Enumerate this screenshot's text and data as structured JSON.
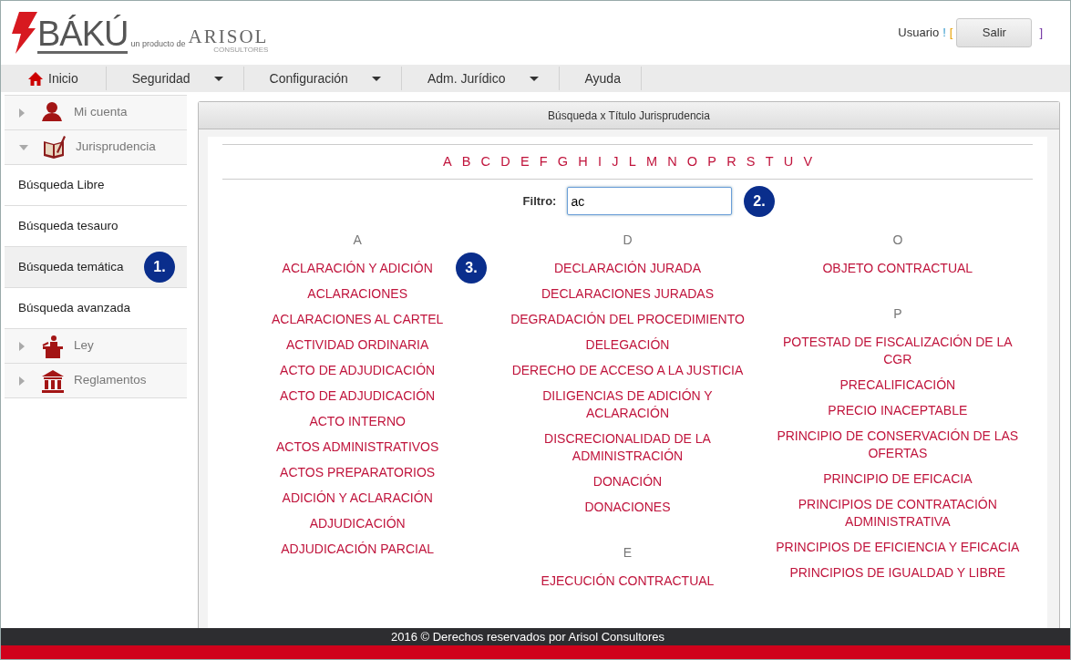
{
  "logo": {
    "brand": "BÁKÚ",
    "tagline": "un producto de",
    "company": "ARISOL",
    "company_sub": "CONSULTORES"
  },
  "user": {
    "greeting": "Usuario",
    "bang": "!",
    "open_bracket": "[",
    "button": "Salir",
    "close_bracket": "]"
  },
  "nav": [
    {
      "label": "Inicio",
      "home": true,
      "has_menu": false
    },
    {
      "label": "Seguridad",
      "home": false,
      "has_menu": true
    },
    {
      "label": "Configuración",
      "home": false,
      "has_menu": true
    },
    {
      "label": "Adm. Jurídico",
      "home": false,
      "has_menu": true
    },
    {
      "label": "Ayuda",
      "home": false,
      "has_menu": false
    }
  ],
  "sidebar": {
    "items": [
      {
        "kind": "section",
        "label": "Mi cuenta",
        "expanded": false
      },
      {
        "kind": "section",
        "label": "Jurisprudencia",
        "expanded": true
      },
      {
        "kind": "link",
        "label": "Búsqueda Libre",
        "selected": false
      },
      {
        "kind": "link",
        "label": "Búsqueda tesauro",
        "selected": false
      },
      {
        "kind": "link",
        "label": "Búsqueda temática",
        "selected": true,
        "badge": "1."
      },
      {
        "kind": "link",
        "label": "Búsqueda avanzada",
        "selected": false
      },
      {
        "kind": "section",
        "label": "Ley",
        "expanded": false
      },
      {
        "kind": "section",
        "label": "Reglamentos",
        "expanded": false
      }
    ]
  },
  "panel": {
    "title": "Búsqueda x Título Jurisprudencia",
    "letters": [
      "A",
      "B",
      "C",
      "D",
      "E",
      "F",
      "G",
      "H",
      "I",
      "J",
      "L",
      "M",
      "N",
      "O",
      "P",
      "R",
      "S",
      "T",
      "U",
      "V"
    ],
    "filter": {
      "label": "Filtro:",
      "value": "ac",
      "badge": "2."
    },
    "results_badge": "3.",
    "columns": [
      {
        "groups": [
          {
            "letter": "A",
            "items": [
              "ACLARACIÓN Y ADICIÓN",
              "ACLARACIONES",
              "ACLARACIONES AL CARTEL",
              "ACTIVIDAD ORDINARIA",
              "ACTO DE ADJUDICACIÓN",
              "ACTO DE ADJUDICACIÓN",
              "ACTO INTERNO",
              "ACTOS ADMINISTRATIVOS",
              "ACTOS PREPARATORIOS",
              "ADICIÓN Y ACLARACIÓN",
              "ADJUDICACIÓN",
              "ADJUDICACIÓN PARCIAL"
            ]
          }
        ]
      },
      {
        "groups": [
          {
            "letter": "D",
            "items": [
              "DECLARACIÓN JURADA",
              "DECLARACIONES JURADAS",
              "DEGRADACIÓN DEL PROCEDIMIENTO",
              "DELEGACIÓN",
              "DERECHO DE ACCESO A LA JUSTICIA",
              "DILIGENCIAS DE ADICIÓN Y ACLARACIÓN",
              "DISCRECIONALIDAD DE LA ADMINISTRACIÓN",
              "DONACIÓN",
              "DONACIONES"
            ]
          },
          {
            "letter": "E",
            "items": [
              "EJECUCIÓN CONTRACTUAL"
            ]
          }
        ]
      },
      {
        "groups": [
          {
            "letter": "O",
            "items": [
              "OBJETO CONTRACTUAL"
            ]
          },
          {
            "letter": "P",
            "items": [
              "POTESTAD DE FISCALIZACIÓN DE LA CGR",
              "PRECALIFICACIÓN",
              "PRECIO INACEPTABLE",
              "PRINCIPIO DE CONSERVACIÓN DE LAS OFERTAS",
              "PRINCIPIO DE EFICACIA",
              "PRINCIPIOS DE CONTRATACIÓN ADMINISTRATIVA",
              "PRINCIPIOS DE EFICIENCIA Y EFICACIA",
              "PRINCIPIOS DE IGUALDAD Y LIBRE"
            ]
          }
        ]
      }
    ]
  },
  "footer": "2016 © Derechos reservados por Arisol Consultores"
}
